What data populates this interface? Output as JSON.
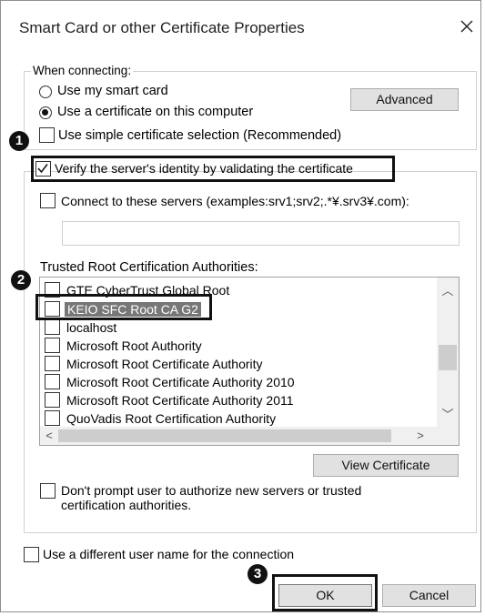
{
  "window": {
    "title": "Smart Card or other Certificate Properties",
    "close_glyph": "✕"
  },
  "when_connecting": {
    "legend": "When connecting:",
    "use_smart_card": "Use my smart card",
    "use_certificate": "Use a certificate on this computer",
    "advanced": "Advanced",
    "simple_selection": "Use simple certificate selection (Recommended)"
  },
  "verify": {
    "label": "Verify the server's identity by validating the certificate",
    "connect_label": "Connect to these servers (examples:srv1;srv2;.*¥.srv3¥.com):",
    "servers_value": ""
  },
  "trusted": {
    "label": "Trusted Root Certification Authorities:",
    "items": [
      {
        "label": "GTE CyberTrust Global Root",
        "checked": false
      },
      {
        "label": "KEIO SFC Root CA G2",
        "checked": true
      },
      {
        "label": "localhost",
        "checked": false
      },
      {
        "label": "Microsoft Root Authority",
        "checked": false
      },
      {
        "label": "Microsoft Root Certificate Authority",
        "checked": false
      },
      {
        "label": "Microsoft Root Certificate Authority 2010",
        "checked": false
      },
      {
        "label": "Microsoft Root Certificate Authority 2011",
        "checked": false
      },
      {
        "label": "QuoVadis Root Certification Authority",
        "checked": false
      }
    ],
    "view_certificate": "View Certificate",
    "dont_prompt_line1": "Don't prompt user to authorize new servers or trusted",
    "dont_prompt_line2": "certification authorities."
  },
  "different_user": "Use a different user name for the connection",
  "ok": "OK",
  "cancel": "Cancel",
  "markers": [
    "1",
    "2",
    "3"
  ],
  "scroll": {
    "up": "︿",
    "down": "﹀",
    "left": "<",
    "right": ">"
  }
}
